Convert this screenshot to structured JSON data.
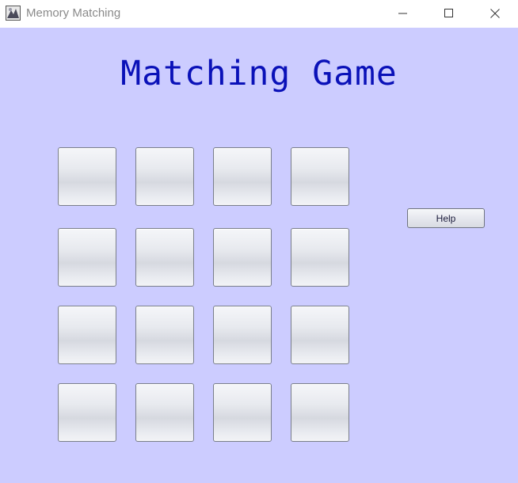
{
  "window": {
    "title": "Memory Matching",
    "icon": "java-app-icon",
    "controls": [
      "minimize-icon",
      "maximize-icon",
      "close-icon"
    ]
  },
  "game": {
    "title": "Matching Game",
    "background_color": "#ccccff",
    "title_color": "#0a11b8",
    "grid_rows": 4,
    "grid_cols": 4,
    "help_label": "Help"
  }
}
